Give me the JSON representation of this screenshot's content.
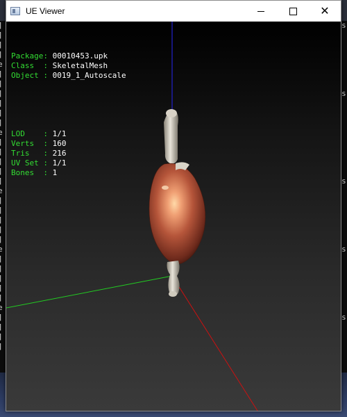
{
  "window": {
    "title": "UE Viewer"
  },
  "overlay": {
    "rows1": [
      {
        "label": "Package: ",
        "value": "00010453.upk"
      },
      {
        "label": "Class  : ",
        "value": "SkeletalMesh"
      },
      {
        "label": "Object : ",
        "value": "0019_1_Autoscale"
      }
    ],
    "rows2": [
      {
        "label": "LOD    : ",
        "value": "1/1"
      },
      {
        "label": "Verts  : ",
        "value": "160"
      },
      {
        "label": "Tris   : ",
        "value": "216"
      },
      {
        "label": "UV Set : ",
        "value": "1/1"
      },
      {
        "label": "Bones  : ",
        "value": "1"
      }
    ]
  },
  "colors": {
    "label_text": "#33dd33",
    "value_text": "#ffffff",
    "axis_x": "#cc1111",
    "axis_y": "#22cc22",
    "axis_z": "#2222cc",
    "mesh": "#b5553a"
  },
  "background_terminal": {
    "left_chars": [
      "]",
      "]",
      "]",
      "]",
      "e",
      "]",
      "]",
      "]",
      "]",
      "]",
      "]",
      "e",
      "]",
      "]",
      "]",
      "]",
      "]",
      "e",
      "]",
      "]",
      "]",
      "]",
      "]",
      "e",
      "]",
      "]",
      "]",
      "]",
      "]",
      "e",
      "]",
      "]",
      "]",
      "]"
    ],
    "right_chars": [
      "s",
      "",
      "",
      "",
      "",
      "",
      "",
      "s",
      "",
      "",
      "",
      "",
      "",
      "",
      "",
      "",
      "s",
      "",
      "",
      "",
      "",
      "",
      "",
      "s",
      "",
      "",
      "",
      "",
      "",
      "",
      "s",
      "",
      "",
      ""
    ]
  }
}
